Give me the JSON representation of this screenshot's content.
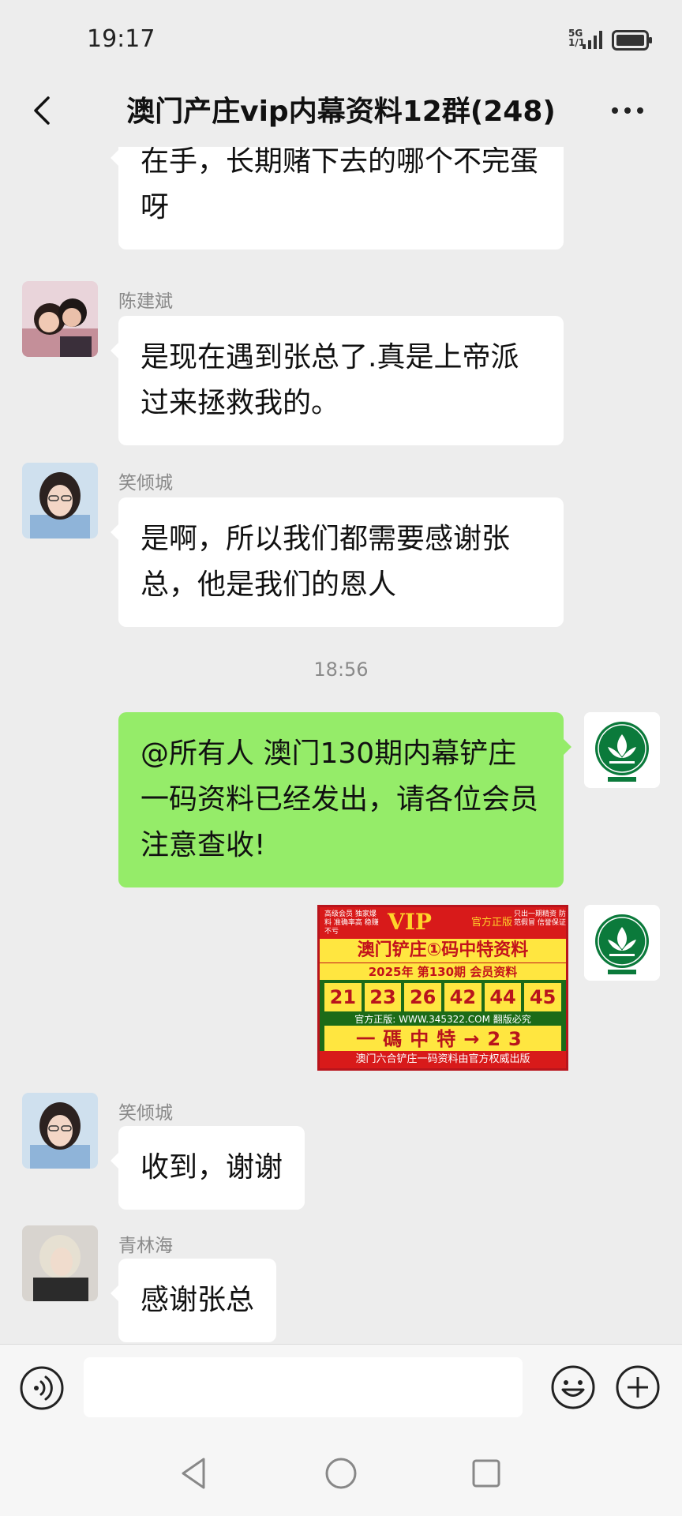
{
  "status": {
    "time": "19:17",
    "network": "5G",
    "network_sub": "1/1"
  },
  "header": {
    "title": "澳门产庄vip内幕资料12群(248)"
  },
  "messages": [
    {
      "type": "in",
      "text": "在手，长期赌下去的哪个不完蛋呀"
    },
    {
      "type": "in",
      "sender": "陈建斌",
      "text": "是现在遇到张总了.真是上帝派过来拯救我的。"
    },
    {
      "type": "in",
      "sender": "笑倾城",
      "text": "是啊，所以我们都需要感谢张总，他是我们的恩人"
    },
    {
      "type": "time",
      "text": "18:56"
    },
    {
      "type": "out",
      "text": "@所有人 澳门130期内幕铲庄一码资料已经发出，请各位会员注意查收!"
    },
    {
      "type": "in",
      "sender": "笑倾城",
      "text": "收到，谢谢"
    },
    {
      "type": "in",
      "sender": "青林海",
      "text": "感谢张总"
    }
  ],
  "promo_image": {
    "vip": "VIP",
    "version": "官方正版",
    "left_note": "高级会员 独家爆料 准确率高 稳赚不亏",
    "right_note": "只出一期精资 防范假冒 信誉保证",
    "headline": "澳门铲庄①码中特资料",
    "period": "2025年 第130期 会员资料",
    "numbers": [
      "21",
      "23",
      "26",
      "42",
      "44",
      "45"
    ],
    "site": "官方正版: WWW.345322.COM 翻版必究",
    "code_line": "一碼中特→23",
    "footer": "澳门六合铲庄一码资料由官方权威出版"
  },
  "colors": {
    "background": "#ededed",
    "bubble_out": "#95ec69",
    "bubble_in": "#ffffff"
  },
  "icons": [
    "back-arrow-icon",
    "more-dots-icon",
    "voice-icon",
    "emoji-icon",
    "plus-icon",
    "nav-back-icon",
    "nav-home-icon",
    "nav-recent-icon"
  ]
}
